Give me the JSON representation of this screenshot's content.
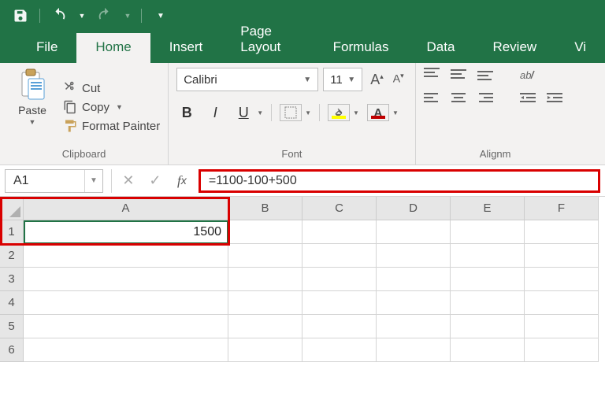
{
  "tabs": {
    "file": "File",
    "home": "Home",
    "insert": "Insert",
    "pageLayout": "Page Layout",
    "formulas": "Formulas",
    "data": "Data",
    "review": "Review",
    "viewPartial": "Vi"
  },
  "clipboard": {
    "paste": "Paste",
    "cut": "Cut",
    "copy": "Copy",
    "formatPainter": "Format Painter",
    "groupLabel": "Clipboard"
  },
  "font": {
    "name": "Calibri",
    "size": "11",
    "groupLabel": "Font",
    "bold": "B",
    "italic": "I",
    "underline": "U",
    "fontColorLetter": "A",
    "increaseFont": "A",
    "decreaseFont": "A"
  },
  "alignment": {
    "groupLabel": "Alignm"
  },
  "formulaBar": {
    "nameBox": "A1",
    "formula": "=1100-100+500"
  },
  "columns": [
    "A",
    "B",
    "C",
    "D",
    "E",
    "F"
  ],
  "rows": [
    "1",
    "2",
    "3",
    "4",
    "5",
    "6"
  ],
  "cellA1": "1500"
}
